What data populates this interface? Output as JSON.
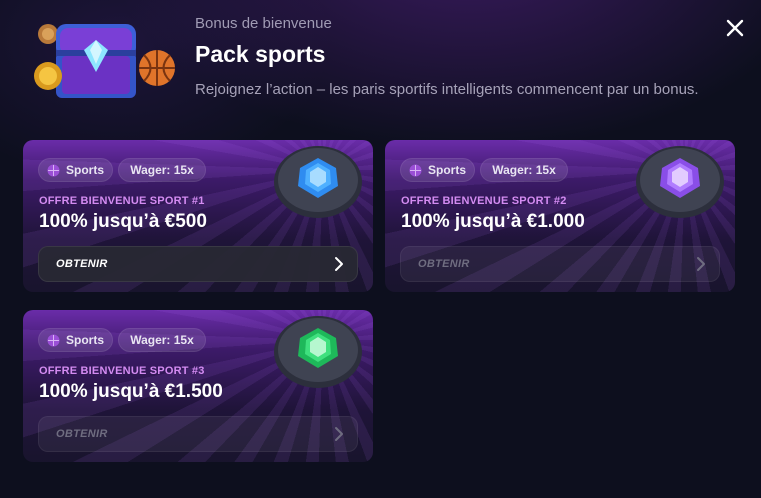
{
  "header": {
    "subtitle": "Bonus de bienvenue",
    "title": "Pack sports",
    "description": "Rejoignez l’action – les paris sportifs intelligents commencent par un bonus."
  },
  "icons": {
    "close": "close-icon",
    "chest": "treasure-chest-icon",
    "sport": "sport-ball-icon",
    "chevron": "chevron-right-icon",
    "gem": "gem-stone-icon"
  },
  "colors": {
    "background": "#0d0f1e",
    "card_top": "#7830be",
    "offer_label": "#d48cf2",
    "gem_blue": "#4fb0ff",
    "gem_purple": "#b07cff",
    "gem_green": "#3fe07e"
  },
  "offers": [
    {
      "tag": "Sports",
      "wager": "Wager: 15x",
      "label": "OFFRE BIENVENUE SPORT #1",
      "value": "100% jusqu’à €500",
      "button": "OBTENIR",
      "gem_color": "blue",
      "button_active": true
    },
    {
      "tag": "Sports",
      "wager": "Wager: 15x",
      "label": "OFFRE BIENVENUE SPORT #2",
      "value": "100% jusqu’à €1.000",
      "button": "OBTENIR",
      "gem_color": "purple",
      "button_active": false
    },
    {
      "tag": "Sports",
      "wager": "Wager: 15x",
      "label": "OFFRE BIENVENUE SPORT #3",
      "value": "100% jusqu’à €1.500",
      "button": "OBTENIR",
      "gem_color": "green",
      "button_active": false
    }
  ]
}
